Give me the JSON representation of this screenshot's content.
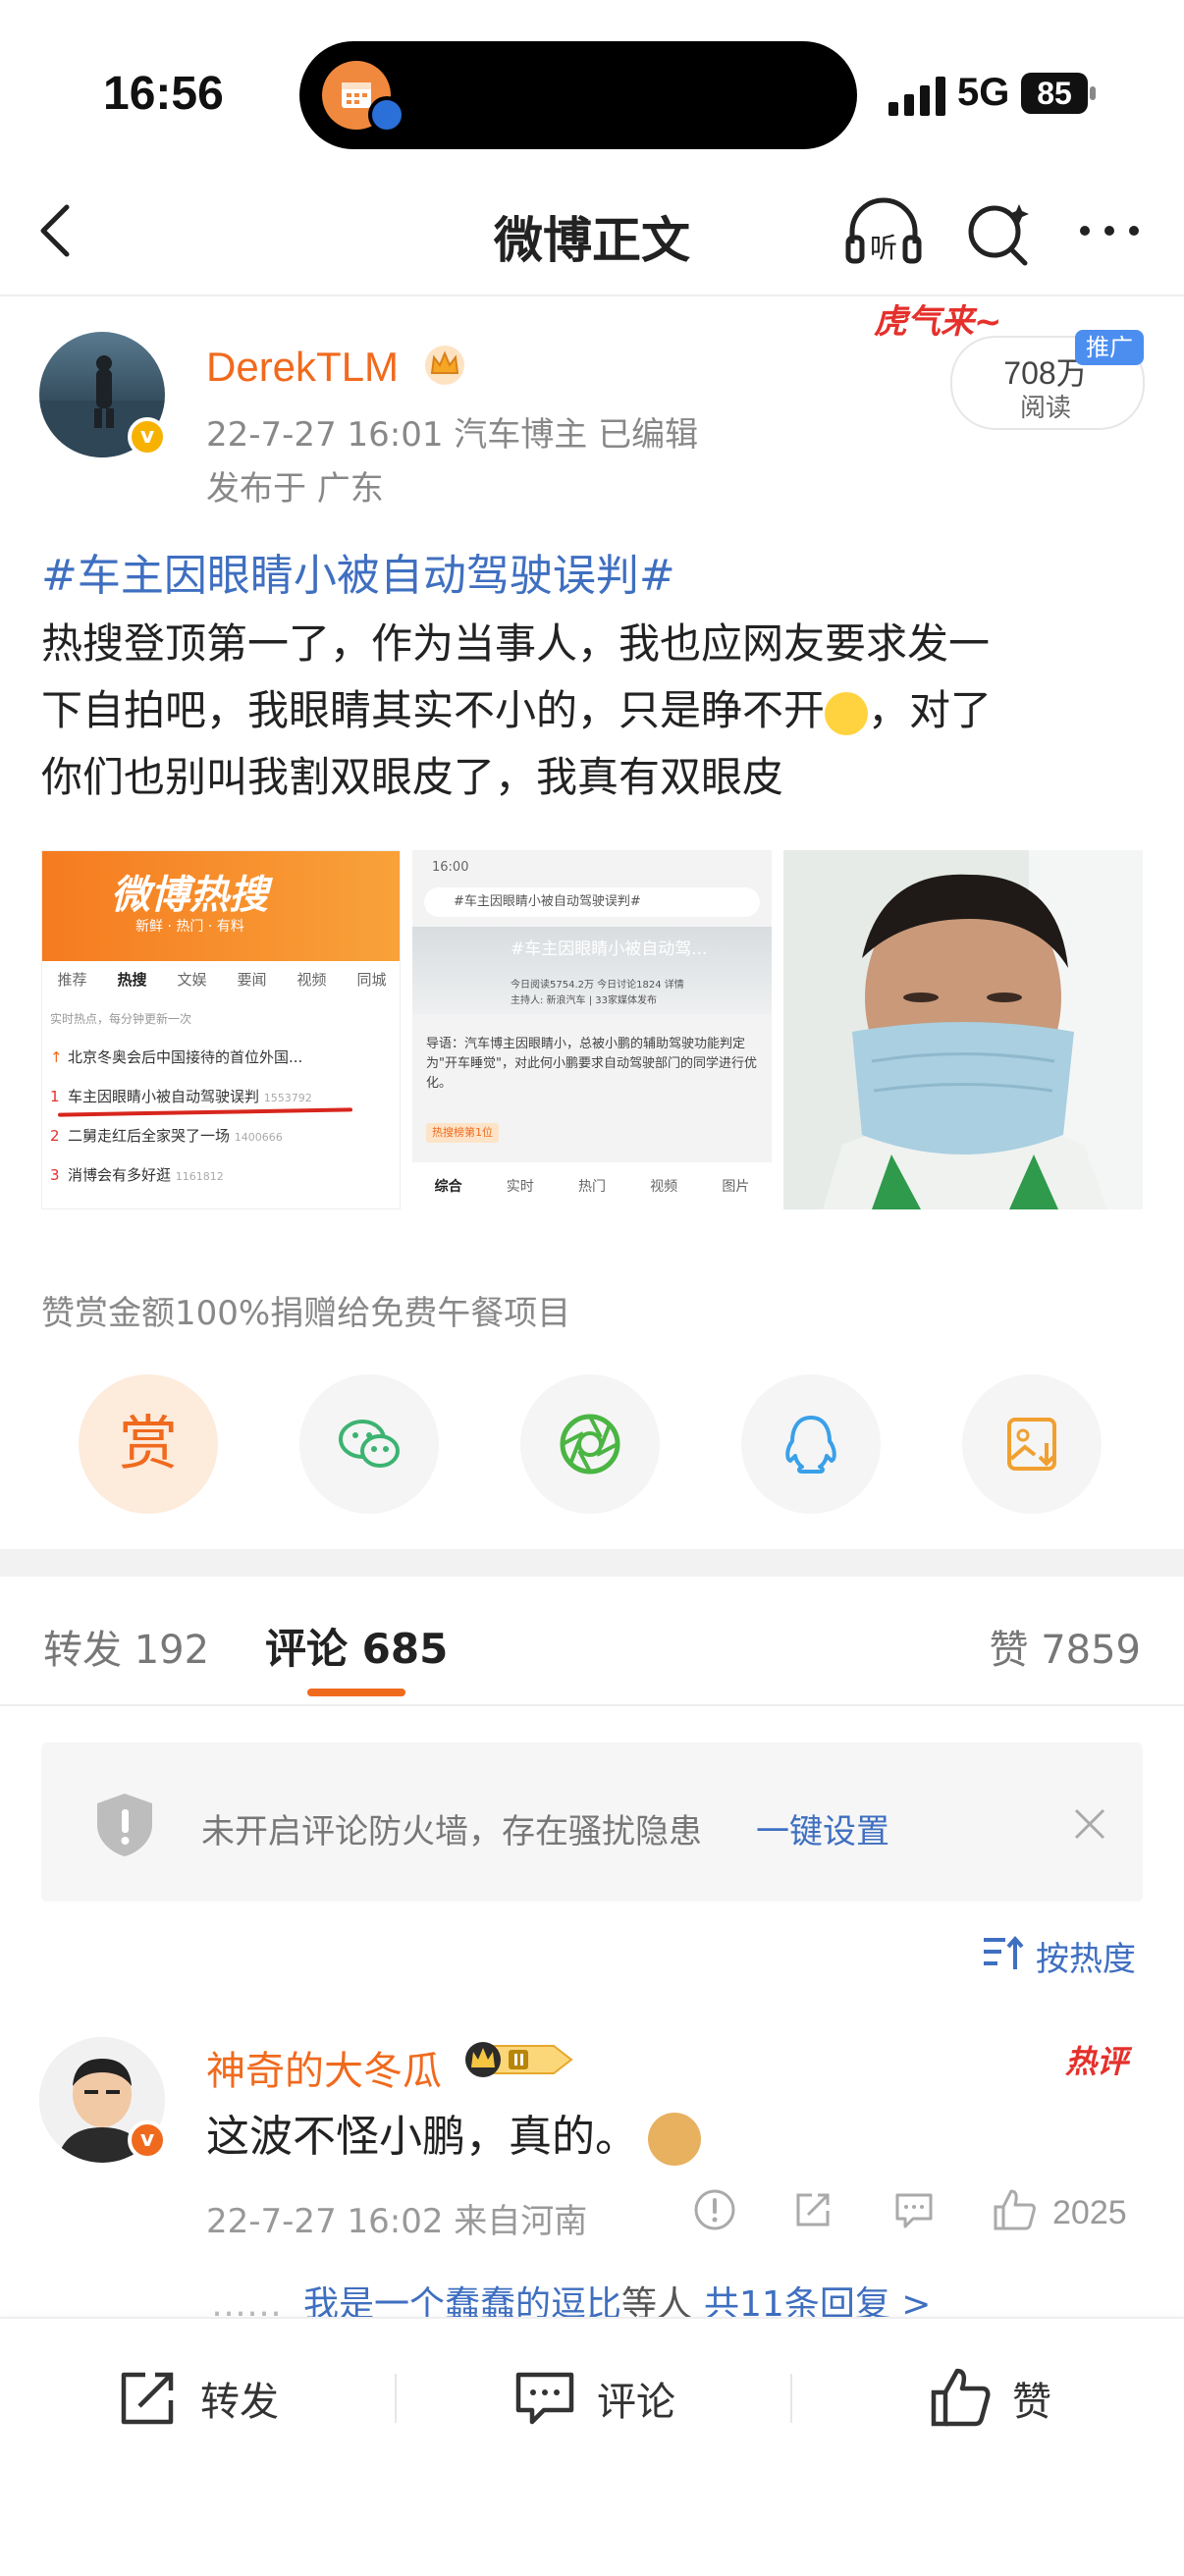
{
  "status_bar": {
    "time": "16:56",
    "network": "5G",
    "battery": "85"
  },
  "nav": {
    "title": "微博正文"
  },
  "post": {
    "author": "DerekTLM",
    "time_source": "22-7-27 16:01  汽车博主  已编辑",
    "location": "发布于 广东",
    "read_count": "708万",
    "read_label": "阅读",
    "promo_tag": "推广",
    "promo_art": "虎气来~",
    "hashtag": "#车主因眼睛小被自动驾驶误判#",
    "body_lines": [
      "热搜登顶第一了，作为当事人，我也应网友要求发一",
      "下自拍吧，我眼睛其实不小的，只是睁不开",
      "，对了",
      "你们也别叫我割双眼皮了，我真有双眼皮"
    ]
  },
  "image1": {
    "banner": "微博热搜",
    "banner_sub": "新鲜 · 热门 · 有料",
    "tabs": [
      "推荐",
      "热搜",
      "文娱",
      "要闻",
      "视频",
      "同城"
    ],
    "note": "实时热点，每分钟更新一次",
    "rows": [
      {
        "rank": "",
        "text": "北京冬奥会后中国接待的首位外国...",
        "num": ""
      },
      {
        "rank": "1",
        "text": "车主因眼睛小被自动驾驶误判",
        "num": "1553792"
      },
      {
        "rank": "2",
        "text": "二舅走红后全家哭了一场",
        "num": "1400666"
      },
      {
        "rank": "3",
        "text": "消博会有多好逛",
        "num": "1161812"
      }
    ]
  },
  "image2": {
    "status": "16:00",
    "search": "#车主因眼睛小被自动驾驶误判#",
    "title": "#车主因眼睛小被自动驾...",
    "stats1": "今日阅读5754.2万  今日讨论1824  详情",
    "stats2": "主持人: 新浪汽车 | 33家媒体发布",
    "intro": "导语：汽车博主因眼睛小，总被小鹏的辅助驾驶功能判定为\"开车睡觉\"，对此何小鹏要求自动驾驶部门的同学进行优化。",
    "rank_tag": "热搜榜第1位",
    "tabs": [
      "综合",
      "实时",
      "热门",
      "视频",
      "图片"
    ]
  },
  "reward": {
    "note": "赞赏金额100%捐赠给免费午餐项目",
    "label": "赏"
  },
  "tabs": {
    "repost": "转发 192",
    "comment": "评论 685",
    "like": "赞 7859"
  },
  "firewall": {
    "text": "未开启评论防火墙，存在骚扰隐患",
    "link": "一键设置"
  },
  "sort": {
    "label": "按热度"
  },
  "comment": {
    "name": "神奇的大冬瓜",
    "hot": "热评",
    "text": "这波不怪小鹏，真的。",
    "meta": "22-7-27 16:02  来自河南",
    "likes": "2025",
    "reply_dots": "……",
    "reply_user": "我是一个蠢蠢的逗比",
    "reply_others": "等人",
    "reply_more": "共11条回复 >"
  },
  "bottom_bar": {
    "repost": "转发",
    "comment": "评论",
    "like": "赞"
  }
}
